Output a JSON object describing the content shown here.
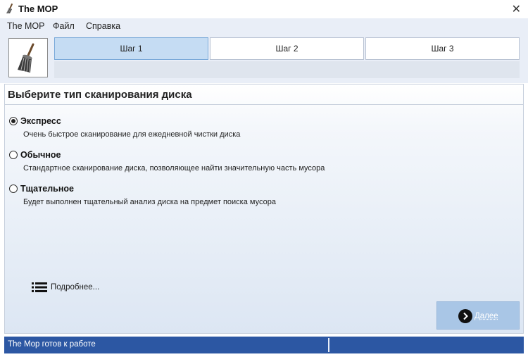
{
  "window": {
    "title": "The MOP",
    "icon": "broom-icon",
    "close_icon": "close-icon"
  },
  "menu": [
    "The MOP",
    "Файл",
    "Справка"
  ],
  "steps": [
    {
      "label": "Шаг 1",
      "active": true
    },
    {
      "label": "Шаг 2",
      "active": false
    },
    {
      "label": "Шаг 3",
      "active": false
    }
  ],
  "panel": {
    "title": "Выберите тип сканирования диска",
    "options": [
      {
        "label": "Экспресс",
        "description": "Очень быстрое сканирование для ежедневной чистки диска",
        "selected": true
      },
      {
        "label": "Обычное",
        "description": "Стандартное сканирование диска, позволяющее найти значительную часть мусора",
        "selected": false
      },
      {
        "label": "Тщательное",
        "description": "Будет выполнен тщательный анализ диска на предмет поиска мусора",
        "selected": false
      }
    ],
    "more_label": "Подробнее...",
    "next_label": "Далее"
  },
  "status": {
    "text": "The Mop готов к работе",
    "color": "#2c57a3"
  },
  "colors": {
    "accent": "#2c57a3",
    "active_step": "#c5dcf3",
    "next_button": "#a9c6e6"
  }
}
